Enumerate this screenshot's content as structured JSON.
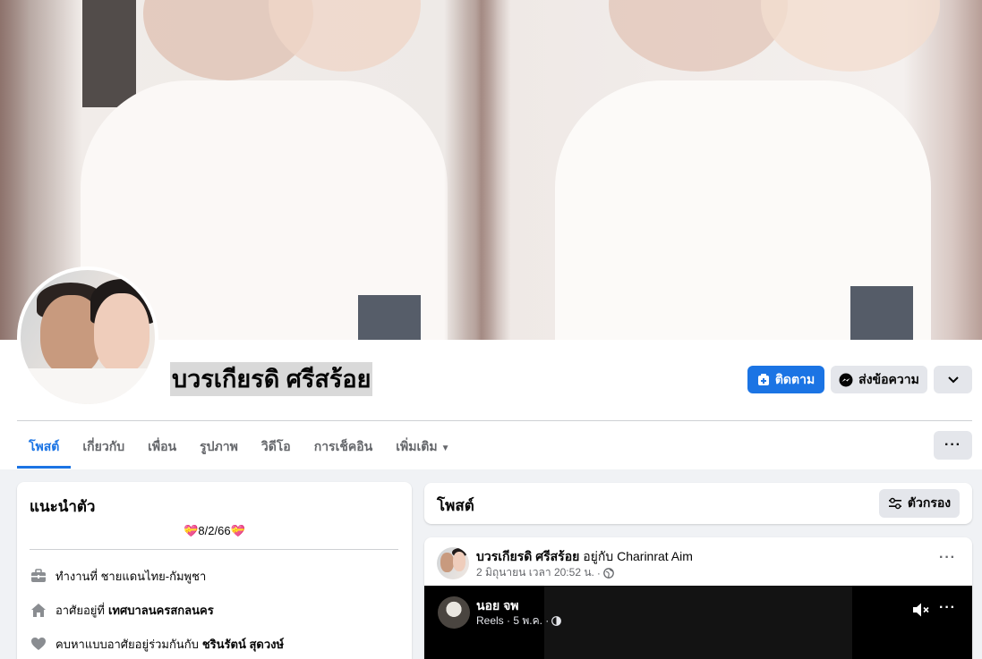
{
  "profile": {
    "name": "บวรเกียรดิ ศรีสร้อย",
    "actions": {
      "follow_label": "ติดตาม",
      "message_label": "ส่งข้อความ"
    }
  },
  "tabs": [
    {
      "label": "โพสต์",
      "active": true
    },
    {
      "label": "เกี่ยวกับ"
    },
    {
      "label": "เพื่อน"
    },
    {
      "label": "รูปภาพ"
    },
    {
      "label": "วิดีโอ"
    },
    {
      "label": "การเช็คอิน"
    },
    {
      "label": "เพิ่มเติม"
    }
  ],
  "intro": {
    "title": "แนะนำตัว",
    "bio": "8/2/66",
    "work": {
      "prefix": "ทำงานที่",
      "value": "ชายแดนไทย-กัมพูชา"
    },
    "lives": {
      "prefix": "อาศัยอยู่ที่",
      "value": "เทศบาลนครสกลนคร"
    },
    "relationship": {
      "prefix": "คบหาแบบอาศัยอยู่ร่วมกันกับ",
      "value": "ชรินรัตน์ สุดวงษ์"
    }
  },
  "posts": {
    "title": "โพสต์",
    "filter_label": "ตัวกรอง"
  },
  "post": {
    "author": "บวรเกียรดิ ศรีสร้อย",
    "with_text": "อยู่กับ",
    "with_name": "Charinrat Aim",
    "time": "2 มิถุนายน เวลา 20:52 น.",
    "dot": "·",
    "reel": {
      "author": "นอย จพ",
      "meta": "Reels · 5 พ.ค. ·"
    }
  },
  "colors": {
    "accent": "#1b74e4",
    "page_bg": "#f0f2f5",
    "secondary_button": "#e4e6eb"
  }
}
